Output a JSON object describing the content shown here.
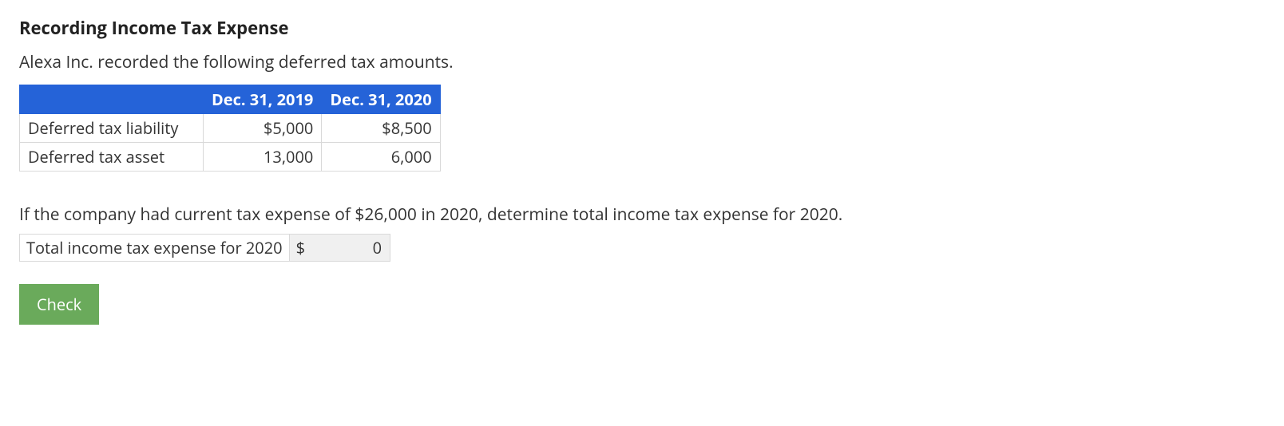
{
  "heading": "Recording Income Tax Expense",
  "intro": "Alexa Inc. recorded the following deferred tax amounts.",
  "table": {
    "headers": [
      "Dec. 31, 2019",
      "Dec. 31, 2020"
    ],
    "rows": [
      {
        "label": "Deferred tax liability",
        "c2019": "$5,000",
        "c2020": "$8,500"
      },
      {
        "label": "Deferred tax asset",
        "c2019": "13,000",
        "c2020": "6,000"
      }
    ]
  },
  "question": "If the company had current tax expense of $26,000 in 2020, determine total income tax expense for 2020.",
  "answer": {
    "label": "Total income tax expense for 2020",
    "currency": "$",
    "value": "0"
  },
  "controls": {
    "check_label": "Check"
  }
}
